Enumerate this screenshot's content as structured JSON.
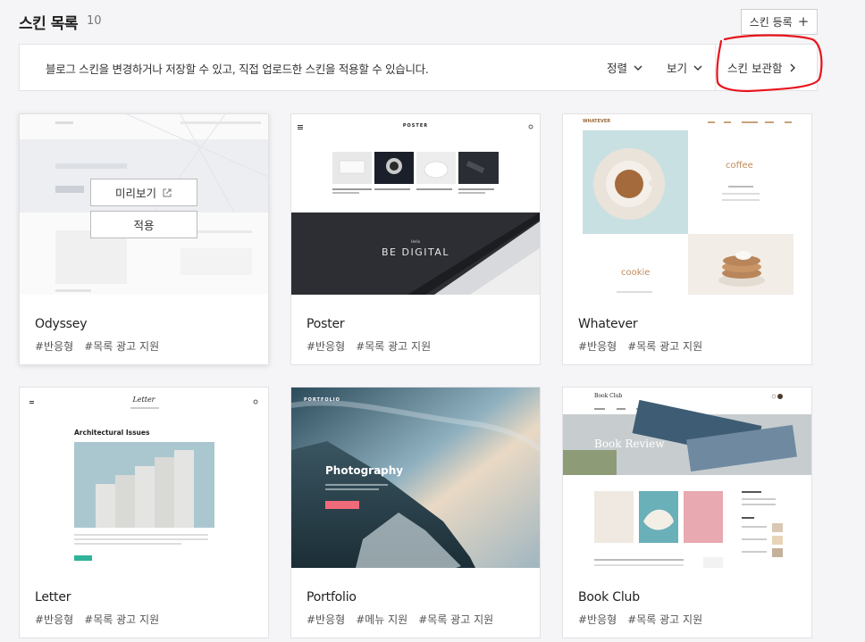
{
  "header": {
    "title": "스킨 목록",
    "count": "10",
    "register_label": "스킨 등록"
  },
  "info_bar": {
    "description": "블로그 스킨을 변경하거나 저장할 수 있고, 직접 업로드한 스킨을 적용할 수 있습니다.",
    "sort_label": "정렬",
    "view_label": "보기",
    "storage_label": "스킨 보관함"
  },
  "colors": {
    "annotation": "#e8141c",
    "accent_pink": "#f06b7a",
    "teal": "#2fb39a"
  },
  "cards": [
    {
      "name": "Odyssey",
      "tags": [
        "#반응형",
        "#목록 광고 지원"
      ],
      "preview_label": "미리보기",
      "apply_label": "적용"
    },
    {
      "name": "Poster",
      "tags": [
        "#반응형",
        "#목록 광고 지원"
      ],
      "thumb_title": "POSTER",
      "banner_text": "BE DIGITAL",
      "banner_sub": "Hello"
    },
    {
      "name": "Whatever",
      "tags": [
        "#반응형",
        "#목록 광고 지원"
      ],
      "thumb_logo": "WHATEVER",
      "text_coffee": "coffee",
      "text_cookie": "cookie"
    },
    {
      "name": "Letter",
      "tags": [
        "#반응형",
        "#목록 광고 지원"
      ],
      "thumb_logo": "Letter",
      "headline": "Architectural Issues"
    },
    {
      "name": "Portfolio",
      "tags": [
        "#반응형",
        "#메뉴 지원",
        "#목록 광고 지원"
      ],
      "thumb_logo": "PORTFOLIO",
      "headline": "Photography"
    },
    {
      "name": "Book Club",
      "tags": [
        "#반응형",
        "#목록 광고 지원"
      ],
      "thumb_logo": "Book Club",
      "banner_text": "Book Review"
    }
  ]
}
